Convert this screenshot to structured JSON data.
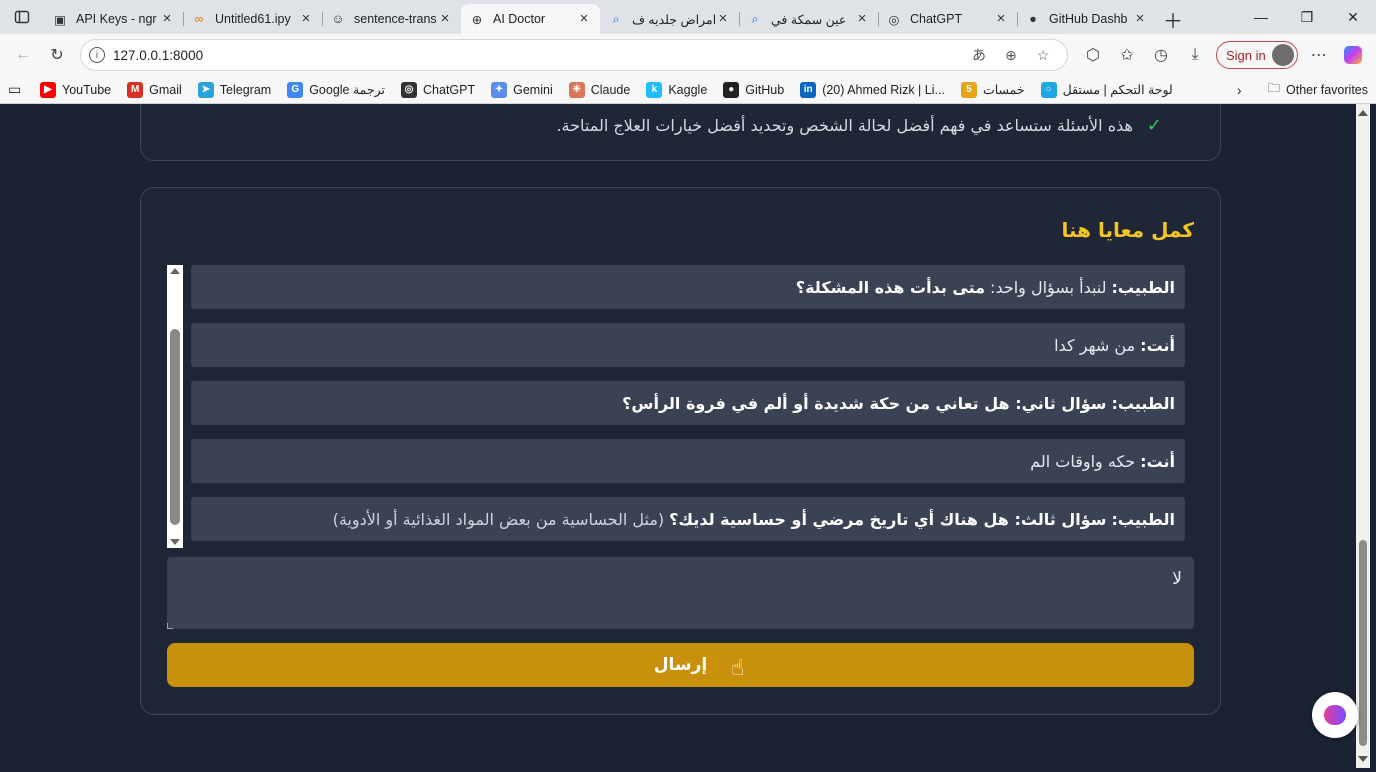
{
  "browser": {
    "tabs": [
      {
        "title": "API Keys - ngr",
        "icon": "ngrok-icon",
        "active": false
      },
      {
        "title": "Untitled61.ipy",
        "icon": "colab-icon",
        "active": false
      },
      {
        "title": "sentence-trans",
        "icon": "huggingface-icon",
        "active": false
      },
      {
        "title": "AI Doctor",
        "icon": "globe-icon",
        "active": true
      },
      {
        "title": "امراض جلديه ف",
        "icon": "search-icon",
        "active": false
      },
      {
        "title": "عين سمكة في",
        "icon": "search-icon",
        "active": false
      },
      {
        "title": "ChatGPT",
        "icon": "chatgpt-icon",
        "active": false
      },
      {
        "title": "GitHub Dashb",
        "icon": "github-icon",
        "active": false
      }
    ],
    "url": "127.0.0.1:8000",
    "signin_label": "Sign in",
    "bookmarks": [
      {
        "label": "YouTube",
        "icon": "youtube-icon",
        "color": "#ff0000",
        "glyph": "▶"
      },
      {
        "label": "Gmail",
        "icon": "gmail-icon",
        "color": "#d93025",
        "glyph": "M"
      },
      {
        "label": "Telegram",
        "icon": "telegram-icon",
        "color": "#2aa3dd",
        "glyph": "➤"
      },
      {
        "label": "Google ترجمة",
        "icon": "google-translate-icon",
        "color": "#4285f4",
        "glyph": "G"
      },
      {
        "label": "ChatGPT",
        "icon": "chatgpt-icon",
        "color": "#333333",
        "glyph": "◎"
      },
      {
        "label": "Gemini",
        "icon": "gemini-icon",
        "color": "#5b8def",
        "glyph": "✦"
      },
      {
        "label": "Claude",
        "icon": "claude-icon",
        "color": "#d97757",
        "glyph": "✳"
      },
      {
        "label": "Kaggle",
        "icon": "kaggle-icon",
        "color": "#20beff",
        "glyph": "k"
      },
      {
        "label": "GitHub",
        "icon": "github-icon",
        "color": "#222222",
        "glyph": "●"
      },
      {
        "label": "(20) Ahmed Rizk | Li...",
        "icon": "linkedin-icon",
        "color": "#0a66c2",
        "glyph": "in"
      },
      {
        "label": "خمسات",
        "icon": "khamsat-icon",
        "color": "#e8a317",
        "glyph": "5"
      },
      {
        "label": "لوحة التحكم | مستقل",
        "icon": "mostaql-icon",
        "color": "#1ea7e4",
        "glyph": "○"
      }
    ],
    "other_favorites": "Other favorites"
  },
  "page": {
    "info_line": "هذه الأسئلة ستساعد في فهم أفضل لحالة الشخص وتحديد أفضل خيارات العلاج المتاحة.",
    "section_title": "كمل معايا هنا",
    "messages": [
      {
        "speaker": "الطبيب:",
        "lead": "لنبدأ بسؤال واحد:",
        "question": "متى بدأت هذه المشكلة؟",
        "extra": ""
      },
      {
        "speaker": "أنت:",
        "lead": "من شهر كدا",
        "question": "",
        "extra": ""
      },
      {
        "speaker": "الطبيب:",
        "lead": "",
        "question": "سؤال ثاني: هل تعاني من حكة شديدة أو ألم في فروة الرأس؟",
        "extra": ""
      },
      {
        "speaker": "أنت:",
        "lead": "حكه واوقات الم",
        "question": "",
        "extra": ""
      },
      {
        "speaker": "الطبيب:",
        "lead": "",
        "question": "سؤال ثالث: هل هناك أي تاريخ مرضي أو حساسية لديك؟",
        "extra": "(مثل الحساسية من بعض المواد الغذائية أو الأدوية)"
      }
    ],
    "reply_value": "لا",
    "send_label": "إرسال"
  },
  "colors": {
    "page_bg": "#1b2232",
    "accent_title": "#f3c623",
    "send_button": "#c8900b",
    "check": "#34c759"
  }
}
